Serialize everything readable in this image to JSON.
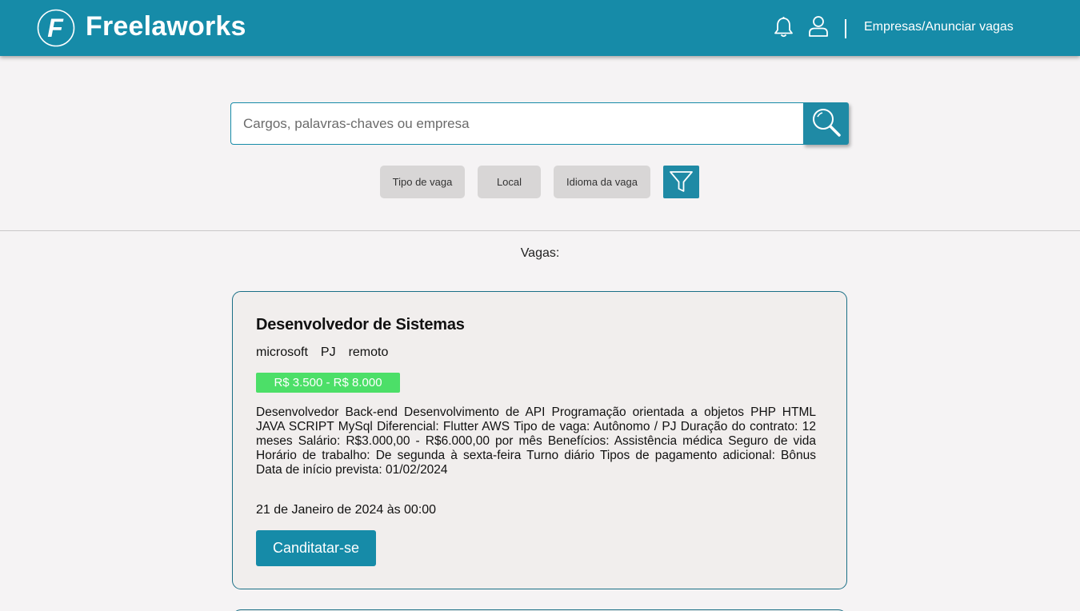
{
  "header": {
    "brand": "Freelaworks",
    "logo_letter": "F",
    "icons": {
      "notifications": "bell-icon",
      "account": "user-icon"
    },
    "companies_link": "Empresas/Anunciar vagas"
  },
  "search": {
    "placeholder": "Cargos, palavras-chaves ou empresa",
    "value": "",
    "button_icon": "search-icon"
  },
  "filters": {
    "chips": [
      "Tipo de vaga",
      "Local",
      "Idioma da vaga"
    ],
    "filter_icon": "funnel-icon"
  },
  "jobs_section": {
    "title": "Vagas:"
  },
  "jobs": [
    {
      "title": "Desenvolvedor de Sistemas",
      "company": "microsoft",
      "contract": "PJ",
      "mode": "remoto",
      "salary": "R$ 3.500 - R$ 8.000",
      "description": "Desenvolvedor Back-end Desenvolvimento de API Programação orientada a objetos PHP HTML JAVA SCRIPT MySql Diferencial: Flutter AWS Tipo de vaga: Autônomo / PJ Duração do contrato: 12 meses Salário: R$3.000,00 - R$6.000,00 por mês Benefícios: Assistência médica Seguro de vida Horário de trabalho: De segunda à sexta-feira Turno diário Tipos de pagamento adicional: Bônus Data de início prevista: 01/02/2024",
      "date": "21 de Janeiro de 2024 às 00:00",
      "apply_label": "Canditatar-se"
    }
  ],
  "colors": {
    "primary": "#168ba8",
    "salary_badge": "#4cdf68",
    "background": "#f5f3f4",
    "card_background": "#f1eeed",
    "chip_background": "#d8d6d6"
  }
}
